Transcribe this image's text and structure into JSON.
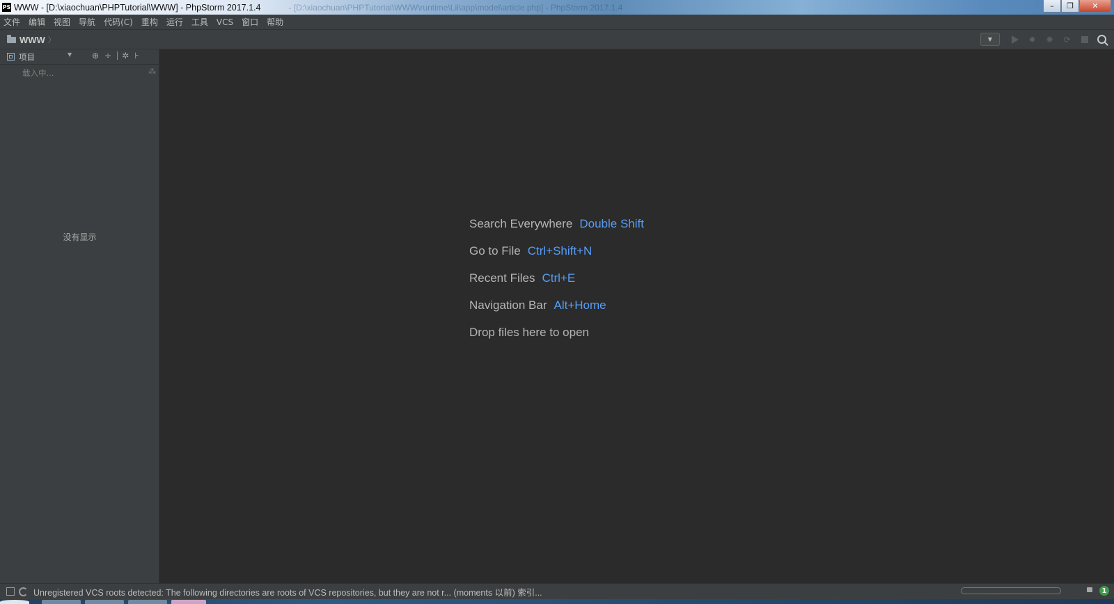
{
  "window": {
    "title": "WWW - [D:\\xiaochuan\\PHPTutorial\\WWW] - PhpStorm 2017.1.4",
    "ghost_title": "- [D:\\xiaochuan\\PHPTutorial\\WWW\\runtime\\Lii\\app\\model\\article.php] - PhpStorm 2017.1.4",
    "logo": "PS",
    "controls": {
      "minimize": "–",
      "restore": "❐",
      "close": "✕"
    }
  },
  "menu": [
    "文件",
    "编辑",
    "视图",
    "导航",
    "代码(C)",
    "重构",
    "运行",
    "工具",
    "VCS",
    "窗口",
    "帮助"
  ],
  "breadcrumb": {
    "label": "WWW",
    "arrow": "〉"
  },
  "project_panel": {
    "title": "项目",
    "loading": "载入中...",
    "empty": "没有显示",
    "tools": [
      "⊕",
      "÷",
      "✲",
      "⊦"
    ]
  },
  "editor_hints": [
    {
      "label": "Search Everywhere",
      "key": "Double Shift"
    },
    {
      "label": "Go to File",
      "key": "Ctrl+Shift+N"
    },
    {
      "label": "Recent Files",
      "key": "Ctrl+E"
    },
    {
      "label": "Navigation Bar",
      "key": "Alt+Home"
    },
    {
      "label": "Drop files here to open",
      "key": ""
    }
  ],
  "status": {
    "message": "Unregistered VCS roots detected: The following directories are roots of VCS repositories, but they are not r... (moments 以前)  索引...",
    "event_count": "1"
  },
  "colors": {
    "background": "#2b2b2b",
    "panel": "#3c3f41",
    "shortcut": "#589df6",
    "hint_text": "#b5b5b5"
  },
  "icons": [
    "ps-logo",
    "folder-icon",
    "run-icon",
    "debug-icon",
    "coverage-icon",
    "profile-icon",
    "stop-icon",
    "search-icon",
    "lock-icon",
    "event-log-icon"
  ]
}
